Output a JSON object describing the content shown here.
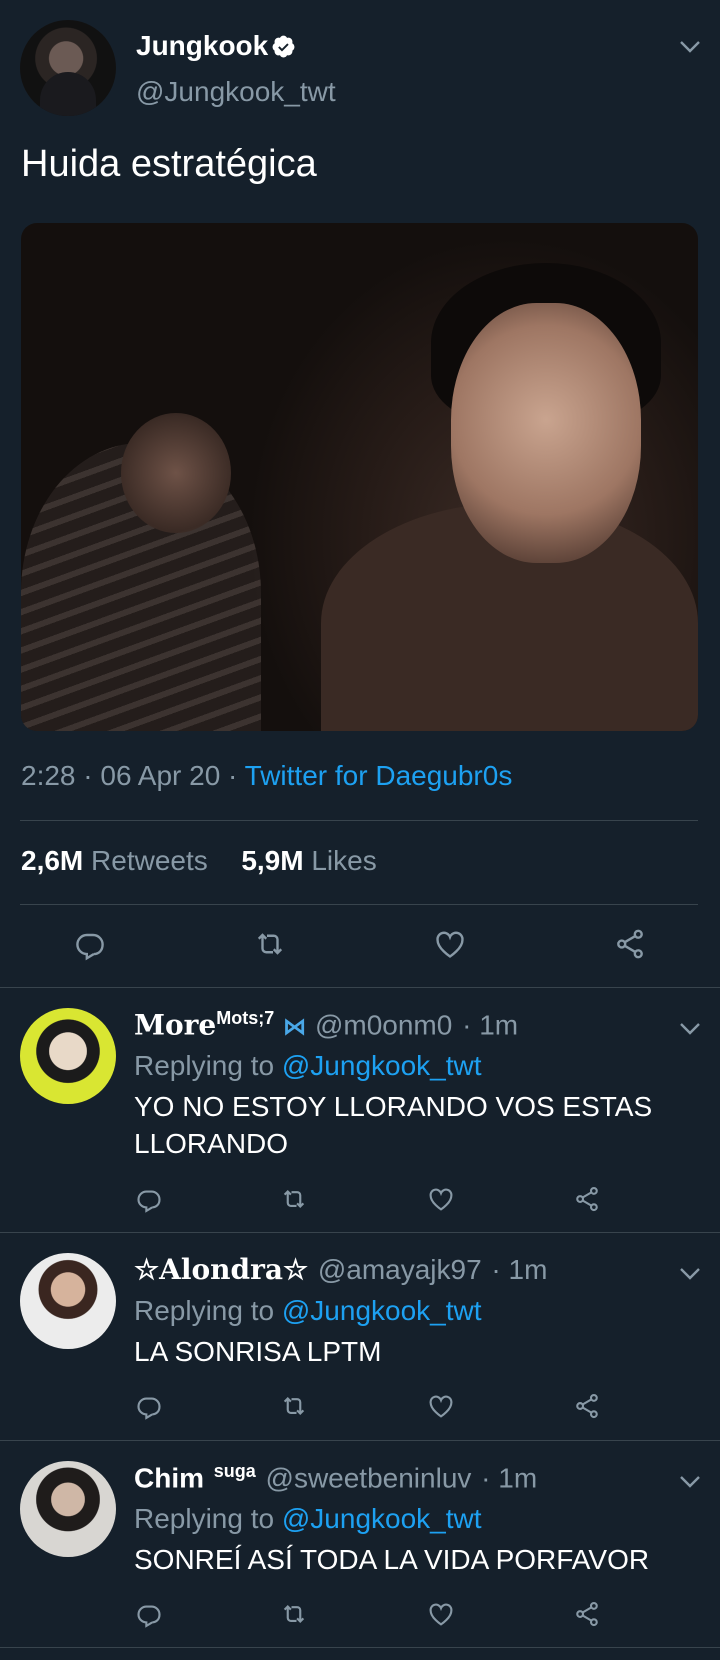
{
  "tweet": {
    "display_name": "Jungkook",
    "handle": "@Jungkook_twt",
    "text": "Huida estratégica",
    "time": "2:28",
    "date": "06 Apr 20",
    "source": "Twitter for Daegubr0s",
    "retweets_count": "2,6M",
    "retweets_label": "Retweets",
    "likes_count": "5,9M",
    "likes_label": "Likes"
  },
  "icons": {
    "reply": "reply-icon",
    "retweet": "retweet-icon",
    "like": "like-icon",
    "share": "share-icon",
    "caret": "chevron-down-icon",
    "verified": "verified-badge-icon",
    "butterfly": "butterfly-emoji-icon"
  },
  "colors": {
    "background": "#15202b",
    "secondary_text": "#8899a6",
    "link": "#1da1f2",
    "divider": "#38444d"
  },
  "replies": [
    {
      "display_name": "More",
      "display_name_sup": "Mots;7",
      "handle": "@m0onm0",
      "time": "· 1m",
      "replying_prefix": "Replying to",
      "replying_to": "@Jungkook_twt",
      "text": "YO NO ESTOY LLORANDO VOS ESTAS LLORANDO"
    },
    {
      "display_name": "☆Alondra☆",
      "handle": "@amayajk97",
      "time": "· 1m",
      "replying_prefix": "Replying to",
      "replying_to": "@Jungkook_twt",
      "text": "LA SONRISA LPTM"
    },
    {
      "display_name": "Chim",
      "display_name_sup": "suga",
      "handle": "@sweetbeninluv",
      "time": "· 1m",
      "replying_prefix": "Replying to",
      "replying_to": "@Jungkook_twt",
      "text": "SONREÍ ASÍ TODA LA VIDA PORFAVOR"
    }
  ]
}
